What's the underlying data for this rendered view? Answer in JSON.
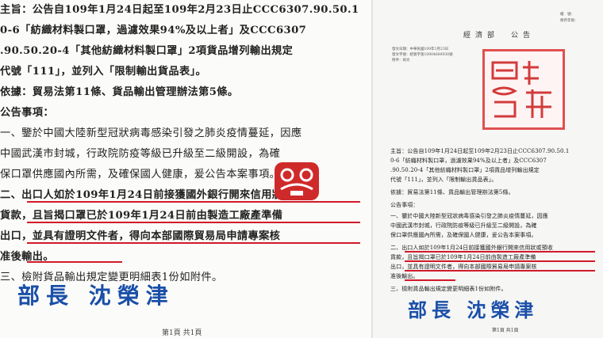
{
  "left_page": {
    "lines": [
      "主旨：公告自109年1月24日起至109年2月23日止CCC6307.90.50.1",
      "      0-6「紡織材料製口罩，過濾效果94%及以上者」及CCC6307",
      "      .90.50.20-4「其他紡織材料製口罩」2項貨品增列輸出規定",
      "      代號「111」，並列入「限制輸出貨品表」。",
      "依據：貿易法第11條、貨品輸出管理辦法第5條。",
      "公告事項：",
      "  一、鑒於中國大陸新型冠狀病毒感染引發之肺炎疫情蔓延，因應",
      "      中國武漢市封城，行政院防疫等級已升級至二級開設，為確",
      "      保口罩供應國內所需，及確保國人健康，爰公告本案事項。",
      "  二、出口人如於109年1月24日前接獲國外銀行開來信用狀或預收",
      "      貨款，且旨揭口罩已於109年1月24日前由製造工廠產準備",
      "      出口，並具有證明文件者，得向本部國際貿易局申請專案核",
      "      准後輸出。",
      "  三、檢附貨品輸出規定變更明細表1份如附件。"
    ],
    "signature": "部長 沈榮津",
    "page_number": "第1頁  共1頁"
  },
  "right_page": {
    "top_right_small": [
      "檔　號：",
      "保存年限："
    ],
    "title": "經濟部　公告",
    "meta": [
      "發文日期：中華民國109年1月23日",
      "發文字號：經貿字第10904600930號",
      "附件：如文"
    ],
    "lines": [
      "主旨：公告自109年1月24日起至109年2月23日止CCC6307.90.50.1",
      "      0-6「紡織材料製口罩，過濾效果94%及以上者」及CCC6307",
      "      .90.50.20-4「其他紡織材料製口罩」2項貨品增列輸出規定",
      "      代號「111」，並列入「限制輸出貨品表」。",
      "依據：貿易法第11條、貨品輸出管理辦法第5條。",
      "公告事項：",
      "  一、鑒於中國大陸新型冠狀病毒感染引發之肺炎疫情蔓延，因應",
      "      中國武漢市封城，行政院防疫等級已升級至二級開設，為確",
      "      保口罩供應國內所需，及確保國人健康，爰公告本案事項。",
      "  二、出口人如於109年1月24日前接獲國外銀行開來信用狀或預收",
      "      貨款，且旨揭口罩已於109年1月24日前由製造工廠產準備",
      "      出口，並具有證明文件者，得向本部國際貿易局申請專案核",
      "      准後輸出。",
      "  三、檢附貨品輸出規定變更明細表1份如附件。"
    ],
    "signature": "部長 沈榮津",
    "page_number": "第1頁 共1頁"
  },
  "colors": {
    "underline": "#d11a2a",
    "signature": "#1a4fa8",
    "seal": "#e05050"
  }
}
